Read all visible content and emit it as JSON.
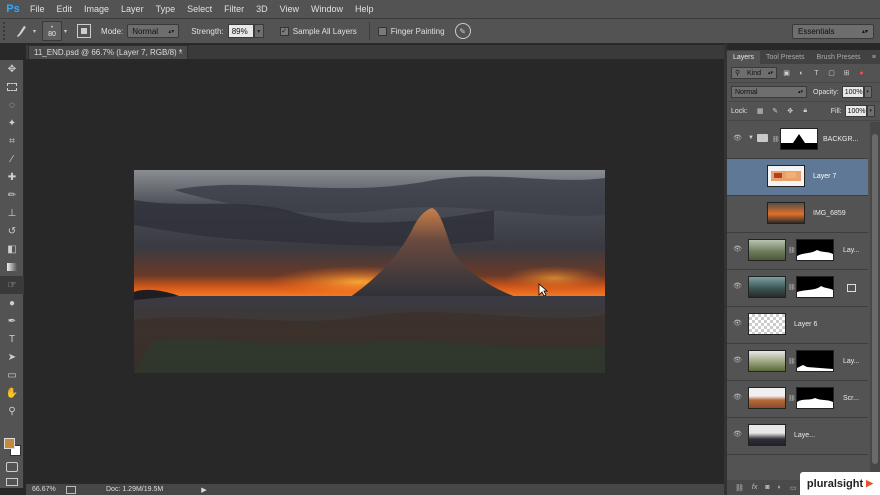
{
  "app": {
    "logo": "Ps"
  },
  "menu": [
    "File",
    "Edit",
    "Image",
    "Layer",
    "Type",
    "Select",
    "Filter",
    "3D",
    "View",
    "Window",
    "Help"
  ],
  "options": {
    "brush_size": "80",
    "mode_label": "Mode:",
    "mode_value": "Normal",
    "strength_label": "Strength:",
    "strength_value": "89%",
    "sample_all_layers": "Sample All Layers",
    "sample_all_checked": true,
    "finger_painting": "Finger Painting",
    "finger_painting_checked": false,
    "workspace": "Essentials"
  },
  "document": {
    "tab_title": "11_END.psd @ 66.7% (Layer 7, RGB/8) *",
    "zoom": "66.67%",
    "doc_size": "Doc: 1.29M/19.5M"
  },
  "panel": {
    "tabs": [
      "Layers",
      "Tool Presets",
      "Brush Presets"
    ],
    "kind_label": "Kind",
    "blend_mode": "Normal",
    "opacity_label": "Opacity:",
    "opacity_value": "100%",
    "lock_label": "Lock:",
    "fill_label": "Fill:",
    "fill_value": "100%"
  },
  "layers": [
    {
      "name": "BACKGR...",
      "kind": "group",
      "selected": false
    },
    {
      "name": "Layer 7",
      "kind": "paint",
      "selected": true
    },
    {
      "name": "IMG_6859",
      "kind": "photo",
      "selected": false
    },
    {
      "name": "Lay...",
      "kind": "masked",
      "selected": false
    },
    {
      "name": "",
      "kind": "masked-smart",
      "selected": false
    },
    {
      "name": "Layer 6",
      "kind": "empty",
      "selected": false
    },
    {
      "name": "Lay...",
      "kind": "masked",
      "selected": false
    },
    {
      "name": "Scr...",
      "kind": "masked-sand",
      "selected": false
    },
    {
      "name": "Laye...",
      "kind": "masked",
      "selected": false
    }
  ],
  "colors": {
    "foreground": "#c48a3a",
    "background": "#ffffff",
    "selection": "#5e7896"
  },
  "watermark": "pluralsight"
}
